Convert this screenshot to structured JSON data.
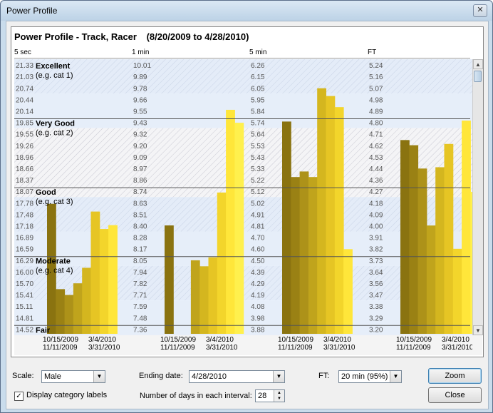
{
  "window": {
    "title": "Power Profile",
    "close_symbol": "✕"
  },
  "chart": {
    "title": "Power Profile - Track, Racer",
    "date_range": "(8/20/2009 to 4/28/2010)",
    "headers": [
      "5 sec",
      "1 min",
      "5 min",
      "FT"
    ]
  },
  "chart_data": {
    "type": "bar",
    "y_rows": {
      "5 sec": [
        "21.33",
        "21.03",
        "20.74",
        "20.44",
        "20.14",
        "19.85",
        "19.55",
        "19.26",
        "18.96",
        "18.66",
        "18.37",
        "18.07",
        "17.78",
        "17.48",
        "17.18",
        "16.89",
        "16.59",
        "16.29",
        "16.00",
        "15.70",
        "15.41",
        "15.11",
        "14.81",
        "14.52"
      ],
      "1 min": [
        "10.01",
        "9.89",
        "9.78",
        "9.66",
        "9.55",
        "9.43",
        "9.32",
        "9.20",
        "9.09",
        "8.97",
        "8.86",
        "8.74",
        "8.63",
        "8.51",
        "8.40",
        "8.28",
        "8.17",
        "8.05",
        "7.94",
        "7.82",
        "7.71",
        "7.59",
        "7.48",
        "7.36"
      ],
      "5 min": [
        "6.26",
        "6.15",
        "6.05",
        "5.95",
        "5.84",
        "5.74",
        "5.64",
        "5.53",
        "5.43",
        "5.33",
        "5.22",
        "5.12",
        "5.02",
        "4.91",
        "4.81",
        "4.70",
        "4.60",
        "4.50",
        "4.39",
        "4.29",
        "4.19",
        "4.08",
        "3.98",
        "3.88"
      ],
      "FT": [
        "5.24",
        "5.16",
        "5.07",
        "4.98",
        "4.89",
        "4.80",
        "4.71",
        "4.62",
        "4.53",
        "4.44",
        "4.36",
        "4.27",
        "4.18",
        "4.09",
        "4.00",
        "3.91",
        "3.82",
        "3.73",
        "3.64",
        "3.56",
        "3.47",
        "3.38",
        "3.29",
        "3.20"
      ]
    },
    "categories": [
      {
        "name": "Excellent",
        "example": "(e.g. cat 1)"
      },
      {
        "name": "Very Good",
        "example": "(e.g. cat 2)"
      },
      {
        "name": "Good",
        "example": "(e.g. cat 3)"
      },
      {
        "name": "Moderate",
        "example": "(e.g. cat 4)"
      },
      {
        "name": "Fair",
        "example": ""
      }
    ],
    "series": [
      {
        "name": "5 sec",
        "values": [
          17.75,
          15.55,
          15.4,
          15.7,
          16.1,
          17.55,
          17.1,
          17.2
        ]
      },
      {
        "name": "1 min",
        "values": [
          8.4,
          null,
          null,
          8.05,
          7.99,
          8.08,
          8.73,
          9.56,
          9.43
        ]
      },
      {
        "name": "5 min",
        "values": [
          5.75,
          5.25,
          5.3,
          5.25,
          6.05,
          5.98,
          5.88,
          4.6
        ]
      },
      {
        "name": "FT",
        "values": [
          4.66,
          4.62,
          4.44,
          4.0,
          4.45,
          4.63,
          3.82,
          4.81,
          4.26
        ]
      }
    ],
    "x_tick_labels": [
      [
        "10/15/2009",
        "3/4/2010"
      ],
      [
        "11/11/2009",
        "3/31/2010"
      ]
    ]
  },
  "controls": {
    "scale_label": "Scale:",
    "scale_value": "Male",
    "ending_date_label": "Ending date:",
    "ending_date_value": "4/28/2010",
    "ft_label": "FT:",
    "ft_value": "20 min (95%)",
    "zoom_label": "Zoom",
    "close_label": "Close",
    "display_labels_text": "Display category labels",
    "display_labels_checked": "✓",
    "days_label": "Number of days in each interval:",
    "days_value": "28"
  }
}
